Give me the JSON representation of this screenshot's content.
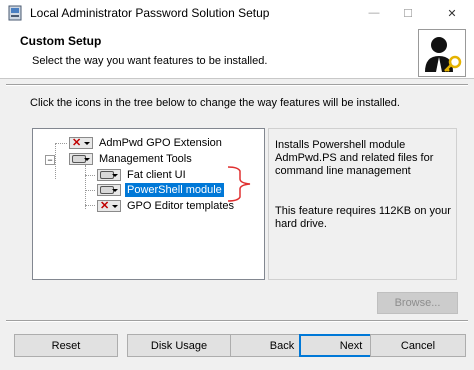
{
  "window": {
    "title": "Local Administrator Password Solution Setup",
    "controls": {
      "minimize": "—",
      "maximize": "☐",
      "close": "✕"
    }
  },
  "header": {
    "title": "Custom Setup",
    "subtitle": "Select the way you want features to be installed."
  },
  "instructions": "Click the icons in the tree below to change the way features will be installed.",
  "tree": {
    "items": [
      {
        "label": "AdmPwd GPO Extension",
        "state": "not-installed",
        "icon": "x-icon"
      },
      {
        "label": "Management Tools",
        "state": "install-local",
        "icon": "disk-icon"
      },
      {
        "label": "Fat client UI",
        "state": "install-local",
        "icon": "disk-icon"
      },
      {
        "label": "PowerShell module",
        "state": "install-local",
        "icon": "disk-icon",
        "selected": true
      },
      {
        "label": "GPO Editor templates",
        "state": "not-installed",
        "icon": "x-icon"
      }
    ]
  },
  "description": {
    "text": "Installs Powershell module AdmPwd.PS and related files for command line management",
    "size_note": "This feature requires 112KB on your hard drive."
  },
  "buttons": {
    "browse": "Browse...",
    "reset": "Reset",
    "disk_usage": "Disk Usage",
    "back": "Back",
    "next": "Next",
    "cancel": "Cancel"
  },
  "colors": {
    "selection": "#0078d7",
    "annotation": "#e03030",
    "not_installed_x": "#c00000"
  }
}
